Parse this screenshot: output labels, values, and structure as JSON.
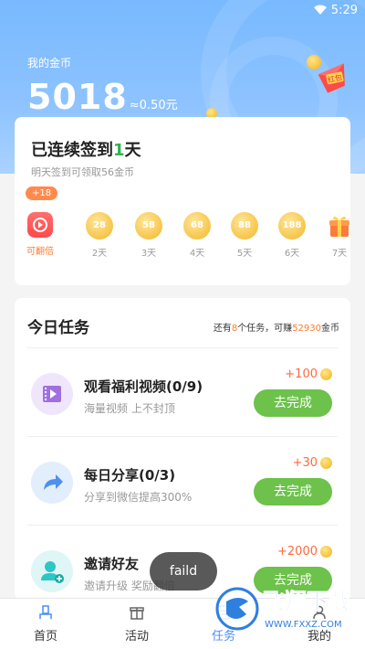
{
  "status_bar": {
    "time": "5:29"
  },
  "header": {
    "gold_label": "我的金币",
    "gold_amount": "5018",
    "cash_equivalent": "≈0.50元",
    "red_packet_label": "红包"
  },
  "checkin": {
    "title_prefix": "已连续签到",
    "title_days": "1",
    "title_suffix": "天",
    "subtitle": "明天签到可领取56金币",
    "badge": "+18",
    "days": [
      {
        "coin": "",
        "label": "可翻倍"
      },
      {
        "coin": "28",
        "label": "2天"
      },
      {
        "coin": "58",
        "label": "3天"
      },
      {
        "coin": "68",
        "label": "4天"
      },
      {
        "coin": "88",
        "label": "5天"
      },
      {
        "coin": "188",
        "label": "6天"
      },
      {
        "coin": "",
        "label": "7天"
      }
    ]
  },
  "tasks": {
    "title": "今日任务",
    "info_prefix": "还有",
    "info_count": "8",
    "info_middle": "个任务，可赚",
    "info_amount": "52930",
    "info_suffix": "金币",
    "items": [
      {
        "name": "观看福利视频(0/9)",
        "desc": "海量视频 上不封顶",
        "reward": "+100",
        "button": "去完成"
      },
      {
        "name": "每日分享(0/3)",
        "desc": "分享到微信提高300%",
        "reward": "+30",
        "button": "去完成"
      },
      {
        "name": "邀请好友",
        "desc": "邀请升级 奖励翻倍",
        "reward": "+2000",
        "button": "去完成"
      }
    ]
  },
  "toast": {
    "text": "faild"
  },
  "bottom_nav": [
    {
      "label": "首页"
    },
    {
      "label": "活动"
    },
    {
      "label": "任务"
    },
    {
      "label": "我的"
    }
  ],
  "watermark": {
    "text": "飞翔下载",
    "url_text": "WWW.FXXZ.COM"
  },
  "colors": {
    "accent_blue": "#4c8df6",
    "green": "#6cc24a",
    "orange": "#ff7a2c"
  }
}
